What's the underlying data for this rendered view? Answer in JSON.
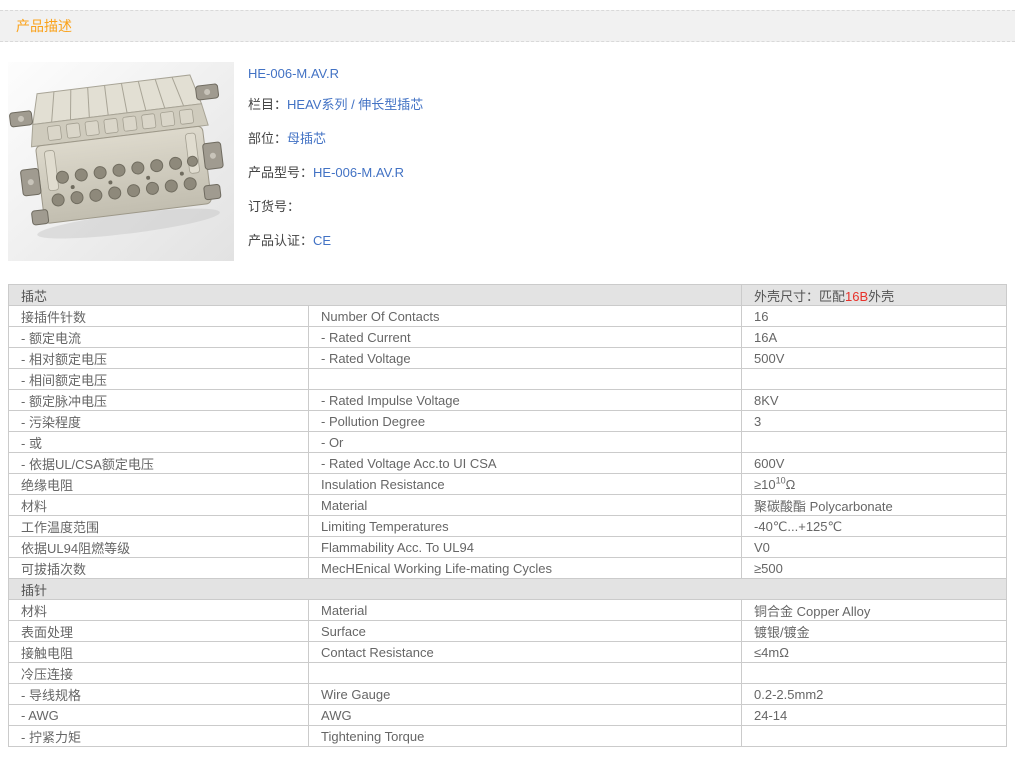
{
  "colors": {
    "accent_orange": "#faa21b",
    "link_blue": "#4272c4",
    "highlight_red": "#e8312a",
    "section_header_bg": "#e3e3e3",
    "table_border": "#cbcbcb",
    "topbar_bg": "#f1f1f1"
  },
  "header": {
    "title": "产品描述"
  },
  "product": {
    "image_name": "connector-photo",
    "title": "HE-006-M.AV.R",
    "f0": {
      "label": "栏目：",
      "link1": "HEAV系列",
      "sep": " / ",
      "link2": "伸长型插芯"
    },
    "f1": {
      "label": "部位：",
      "link": "母插芯"
    },
    "f2": {
      "label": "产品型号：",
      "link": "HE-006-M.AV.R"
    },
    "f3": {
      "label": "订货号："
    },
    "f4": {
      "label": "产品认证：",
      "link": "CE"
    }
  },
  "table": {
    "s1": {
      "title": "插芯",
      "shell_pre": "外壳尺寸：匹配",
      "shell_hl": "16B",
      "shell_post": "外壳",
      "rows": [
        {
          "cn": "接插件针数",
          "en": "Number Of Contacts",
          "val": "16"
        },
        {
          "cn": "- 额定电流",
          "en": "- Rated Current",
          "val": "16A"
        },
        {
          "cn": "- 相对额定电压",
          "en": "- Rated Voltage",
          "val": "500V"
        },
        {
          "cn": "- 相间额定电压",
          "en": "",
          "val": ""
        },
        {
          "cn": "- 额定脉冲电压",
          "en": "- Rated Impulse Voltage",
          "val": "8KV"
        },
        {
          "cn": "- 污染程度",
          "en": "- Pollution Degree",
          "val": "3"
        },
        {
          "cn": "- 或",
          "en": "- Or",
          "val": ""
        },
        {
          "cn": "- 依据UL/CSA额定电压",
          "en": "- Rated Voltage Acc.to UI CSA",
          "val": "600V"
        },
        {
          "cn": "绝缘电阻",
          "en": "Insulation Resistance",
          "val_pre": "≥10",
          "val_sup": "10",
          "val_post": "Ω"
        },
        {
          "cn": "材料",
          "en": "Material",
          "val": "聚碳酸酯 Polycarbonate"
        },
        {
          "cn": "工作温度范围",
          "en": "Limiting Temperatures",
          "val": "-40℃...+125℃"
        },
        {
          "cn": "依据UL94阻燃等级",
          "en": "Flammability Acc. To UL94",
          "val": "V0"
        },
        {
          "cn": "可拔插次数",
          "en": "MecHEnical Working Life-mating Cycles",
          "val": "≥500"
        }
      ]
    },
    "s2": {
      "title": "插针",
      "rows": [
        {
          "cn": "材料",
          "en": "Material",
          "val": "铜合金 Copper Alloy"
        },
        {
          "cn": "表面处理",
          "en": "Surface",
          "val": "镀银/镀金"
        },
        {
          "cn": "接触电阻",
          "en": "Contact Resistance",
          "val": "≤4mΩ"
        },
        {
          "cn": "冷压连接",
          "en": "",
          "val": ""
        },
        {
          "cn": "- 导线规格",
          "en": "Wire Gauge",
          "val": "0.2-2.5mm2"
        },
        {
          "cn": "- AWG",
          "en": "AWG",
          "val": "24-14"
        },
        {
          "cn": "- 拧紧力矩",
          "en": "Tightening Torque",
          "val": ""
        }
      ]
    }
  }
}
